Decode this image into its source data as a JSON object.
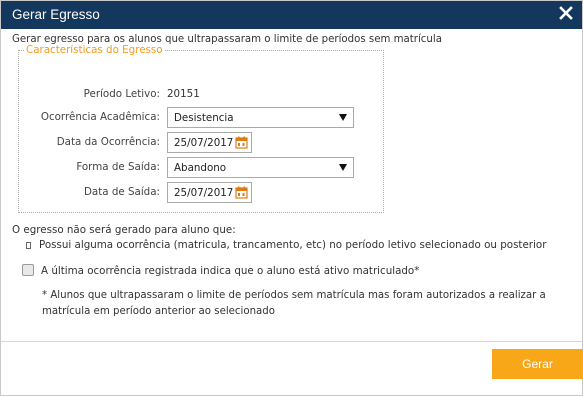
{
  "dialog": {
    "title": "Gerar Egresso",
    "intro": "Gerar egresso para os alunos que ultrapassaram o limite de períodos sem matrícula"
  },
  "fieldset": {
    "legend": "Características do Egresso",
    "periodo_label": "Período Letivo:",
    "periodo_value": "20151",
    "ocorrencia_label": "Ocorrência Acadêmica:",
    "ocorrencia_value": "Desistencia",
    "data_ocorrencia_label": "Data da Ocorrência:",
    "data_ocorrencia_value": "25/07/2017",
    "forma_saida_label": "Forma de Saída:",
    "forma_saida_value": "Abandono",
    "data_saida_label": "Data de Saída:",
    "data_saida_value": "25/07/2017"
  },
  "notes": {
    "heading": "O egresso não será gerado para aluno que:",
    "bullet": "Possui alguma ocorrência (matricula, trancamento, etc) no período letivo selecionado ou posterior",
    "checkbox_label": "A última ocorrência registrada indica que o aluno está ativo matriculado*",
    "footnote": "* Alunos que ultrapassaram o limite de períodos sem matrícula mas foram autorizados a realizar a matrícula em período anterior ao selecionado"
  },
  "buttons": {
    "submit": "Gerar"
  },
  "colors": {
    "titlebar": "#14375e",
    "accent": "#f49b1c",
    "button": "#f8a719"
  },
  "icons": {
    "close": "close-icon",
    "calendar": "calendar-icon"
  }
}
